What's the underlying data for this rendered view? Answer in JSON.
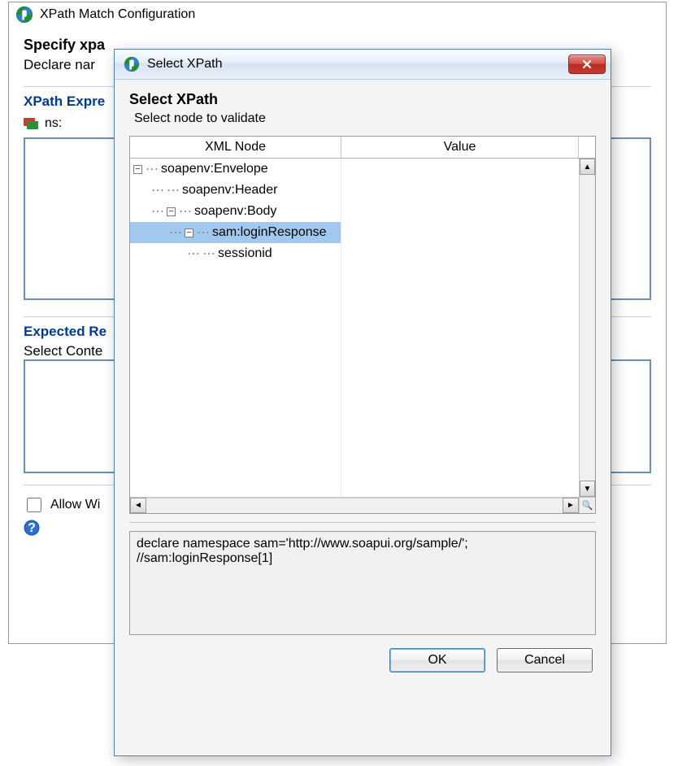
{
  "parent": {
    "title": "XPath Match Configuration",
    "specify_heading": "Specify xpa",
    "declare_label": "Declare nar",
    "xpath_expr_heading": "XPath Expre",
    "ns_label": "ns:",
    "expected_heading": "Expected Re",
    "select_content_label": "Select Conte",
    "allow_label": "Allow Wi"
  },
  "dialog": {
    "title": "Select XPath",
    "heading": "Select XPath",
    "subheading": "Select node to validate",
    "columns": {
      "node": "XML Node",
      "value": "Value"
    },
    "tree": [
      {
        "indent": 0,
        "expander": "-",
        "label": "soapenv:Envelope",
        "value": "",
        "selected": false
      },
      {
        "indent": 1,
        "expander": "",
        "label": "soapenv:Header",
        "value": "",
        "selected": false
      },
      {
        "indent": 1,
        "expander": "-",
        "label": "soapenv:Body",
        "value": "",
        "selected": false
      },
      {
        "indent": 2,
        "expander": "-",
        "label": "sam:loginResponse",
        "value": "",
        "selected": true
      },
      {
        "indent": 3,
        "expander": "",
        "label": "sessionid",
        "value": "?",
        "selected": false
      }
    ],
    "xpath_output": "declare namespace sam='http://www.soapui.org/sample/';\n//sam:loginResponse[1]",
    "buttons": {
      "ok": "OK",
      "cancel": "Cancel"
    }
  }
}
